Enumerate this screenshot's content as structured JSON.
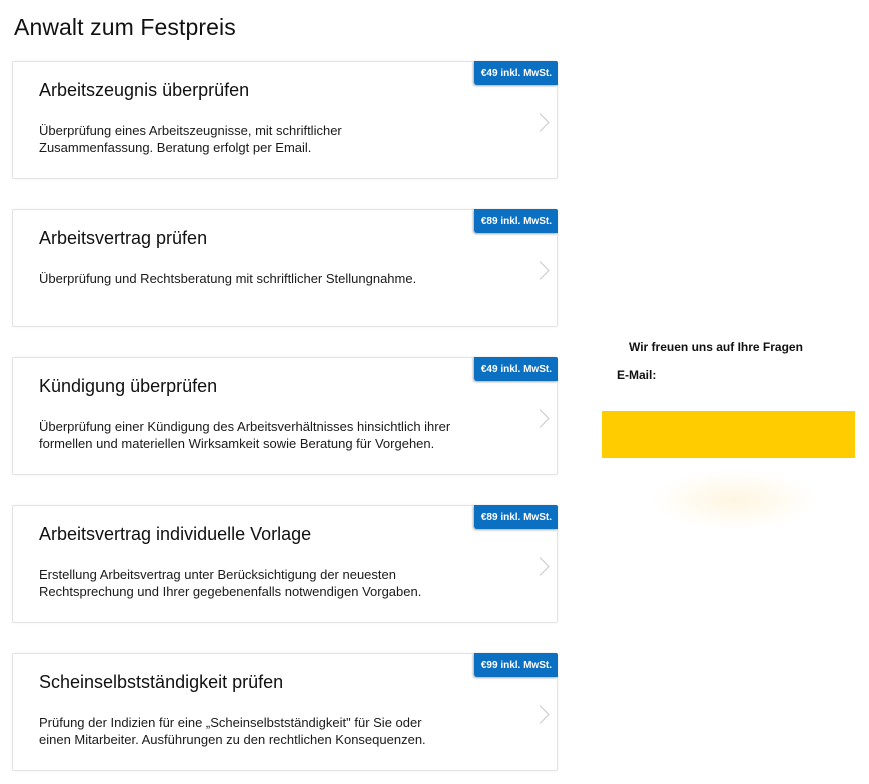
{
  "page": {
    "title": "Anwalt zum Festpreis"
  },
  "services": [
    {
      "title": "Arbeitszeugnis überprüfen",
      "description": "Überprüfung eines Arbeitszeugnisse, mit schriftlicher\nZusammenfassung. Beratung erfolgt per Email.",
      "price": "€49 inkl. MwSt."
    },
    {
      "title": "Arbeitsvertrag prüfen",
      "description": "Überprüfung und Rechtsberatung mit schriftlicher Stellungnahme.",
      "price": "€89 inkl. MwSt."
    },
    {
      "title": "Kündigung überprüfen",
      "description": "Überprüfung einer Kündigung des Arbeitsverhältnisses hinsichtlich ihrer\nformellen und materiellen Wirksamkeit sowie Beratung für Vorgehen.",
      "price": "€49 inkl. MwSt."
    },
    {
      "title": "Arbeitsvertrag individuelle Vorlage",
      "description": "Erstellung Arbeitsvertrag unter Berücksichtigung der neuesten\nRechtsprechung und Ihrer gegebenenfalls notwendigen Vorgaben.",
      "price": "€89 inkl. MwSt."
    },
    {
      "title": "Scheinselbstständigkeit prüfen",
      "description": "Prüfung der Indizien für eine „Scheinselbstständigkeit\" für Sie oder\neinen Mitarbeiter. Ausführungen zu den rechtlichen Konsequenzen.",
      "price": "€99 inkl. MwSt."
    }
  ],
  "contact": {
    "heading": "Wir freuen uns auf Ihre Fragen",
    "email_label": "E-Mail:",
    "email_value": "",
    "email_placeholder": "",
    "submit_label": ""
  },
  "colors": {
    "badge": "#0b6fc2",
    "submit": "#ffcc00"
  },
  "icons": {
    "card_arrow": "chevron-right-icon"
  }
}
